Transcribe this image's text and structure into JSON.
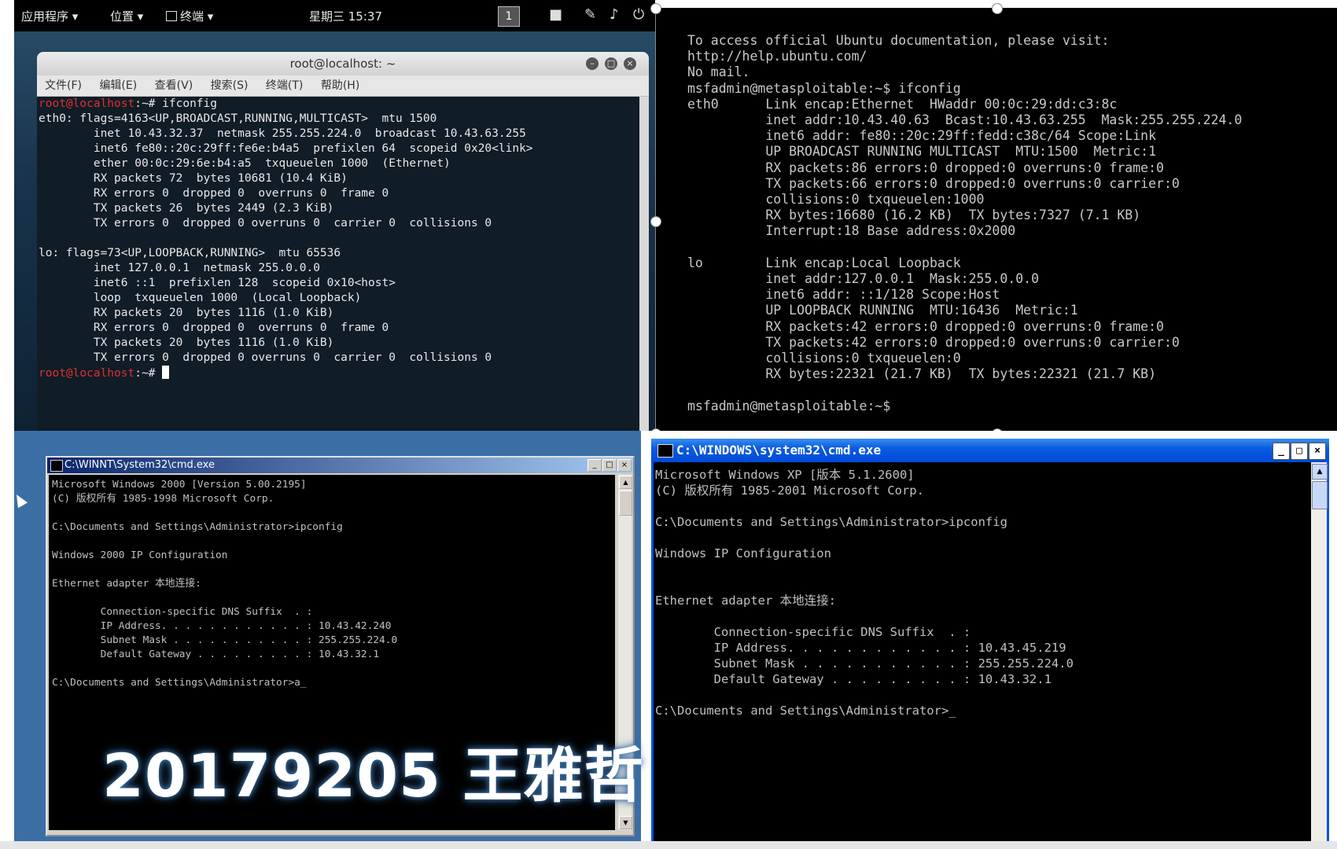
{
  "kali": {
    "topbar": {
      "apps_menu": "应用程序 ▾",
      "places_menu": "位置 ▾",
      "terminal_menu": "终端 ▾",
      "clock": "星期三 15:37",
      "workspace": "1"
    },
    "window": {
      "title": "root@localhost: ~",
      "menu": [
        "文件(F)",
        "编辑(E)",
        "查看(V)",
        "搜索(S)",
        "终端(T)",
        "帮助(H)"
      ],
      "prompt": "root@localhost",
      "prompt_suffix": ":~#",
      "command": " ifconfig",
      "output": "eth0: flags=4163<UP,BROADCAST,RUNNING,MULTICAST>  mtu 1500\n        inet 10.43.32.37  netmask 255.255.224.0  broadcast 10.43.63.255\n        inet6 fe80::20c:29ff:fe6e:b4a5  prefixlen 64  scopeid 0x20<link>\n        ether 00:0c:29:6e:b4:a5  txqueuelen 1000  (Ethernet)\n        RX packets 72  bytes 10681 (10.4 KiB)\n        RX errors 0  dropped 0  overruns 0  frame 0\n        TX packets 26  bytes 2449 (2.3 KiB)\n        TX errors 0  dropped 0 overruns 0  carrier 0  collisions 0\n\nlo: flags=73<UP,LOOPBACK,RUNNING>  mtu 65536\n        inet 127.0.0.1  netmask 255.0.0.0\n        inet6 ::1  prefixlen 128  scopeid 0x10<host>\n        loop  txqueuelen 1000  (Local Loopback)\n        RX packets 20  bytes 1116 (1.0 KiB)\n        RX errors 0  dropped 0  overruns 0  frame 0\n        TX packets 20  bytes 1116 (1.0 KiB)\n        TX errors 0  dropped 0 overruns 0  carrier 0  collisions 0\n"
    }
  },
  "metasploitable": {
    "output": "To access official Ubuntu documentation, please visit:\nhttp://help.ubuntu.com/\nNo mail.\nmsfadmin@metasploitable:~$ ifconfig\neth0      Link encap:Ethernet  HWaddr 00:0c:29:dd:c3:8c\n          inet addr:10.43.40.63  Bcast:10.43.63.255  Mask:255.255.224.0\n          inet6 addr: fe80::20c:29ff:fedd:c38c/64 Scope:Link\n          UP BROADCAST RUNNING MULTICAST  MTU:1500  Metric:1\n          RX packets:86 errors:0 dropped:0 overruns:0 frame:0\n          TX packets:66 errors:0 dropped:0 overruns:0 carrier:0\n          collisions:0 txqueuelen:1000\n          RX bytes:16680 (16.2 KB)  TX bytes:7327 (7.1 KB)\n          Interrupt:18 Base address:0x2000\n\nlo        Link encap:Local Loopback\n          inet addr:127.0.0.1  Mask:255.0.0.0\n          inet6 addr: ::1/128 Scope:Host\n          UP LOOPBACK RUNNING  MTU:16436  Metric:1\n          RX packets:42 errors:0 dropped:0 overruns:0 frame:0\n          TX packets:42 errors:0 dropped:0 overruns:0 carrier:0\n          collisions:0 txqueuelen:0\n          RX bytes:22321 (21.7 KB)  TX bytes:22321 (21.7 KB)\n\nmsfadmin@metasploitable:~$"
  },
  "win2000": {
    "title": "C:\\WINNT\\System32\\cmd.exe",
    "output": "Microsoft Windows 2000 [Version 5.00.2195]\n(C) 版权所有 1985-1998 Microsoft Corp.\n\nC:\\Documents and Settings\\Administrator>ipconfig\n\nWindows 2000 IP Configuration\n\nEthernet adapter 本地连接:\n\n        Connection-specific DNS Suffix  . :\n        IP Address. . . . . . . . . . . . : 10.43.42.240\n        Subnet Mask . . . . . . . . . . . : 255.255.224.0\n        Default Gateway . . . . . . . . . : 10.43.32.1\n\nC:\\Documents and Settings\\Administrator>a_",
    "watermark": "20179205 王雅哲"
  },
  "winxp": {
    "title": "C:\\WINDOWS\\system32\\cmd.exe",
    "output": "Microsoft Windows XP [版本 5.1.2600]\n(C) 版权所有 1985-2001 Microsoft Corp.\n\nC:\\Documents and Settings\\Administrator>ipconfig\n\nWindows IP Configuration\n\n\nEthernet adapter 本地连接:\n\n        Connection-specific DNS Suffix  . :\n        IP Address. . . . . . . . . . . . : 10.43.45.219\n        Subnet Mask . . . . . . . . . . . : 255.255.224.0\n        Default Gateway . . . . . . . . . : 10.43.32.1\n\nC:\\Documents and Settings\\Administrator>_"
  }
}
